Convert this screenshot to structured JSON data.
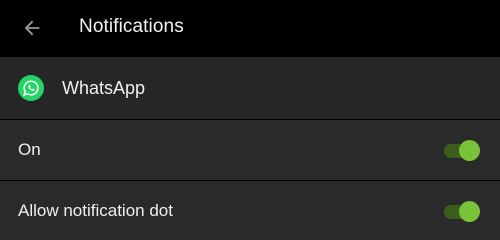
{
  "app_bar": {
    "title": "Notifications",
    "back_icon": "arrow-back-icon"
  },
  "app": {
    "name": "WhatsApp",
    "icon": "whatsapp-icon",
    "icon_color": "#25D366"
  },
  "settings": [
    {
      "label": "On",
      "enabled": true
    },
    {
      "label": "Allow notification dot",
      "enabled": true
    }
  ],
  "colors": {
    "background": "#000000",
    "row_background": "#2a2a2a",
    "toggle_thumb": "#79c23a",
    "toggle_track": "#3b5e1e"
  }
}
